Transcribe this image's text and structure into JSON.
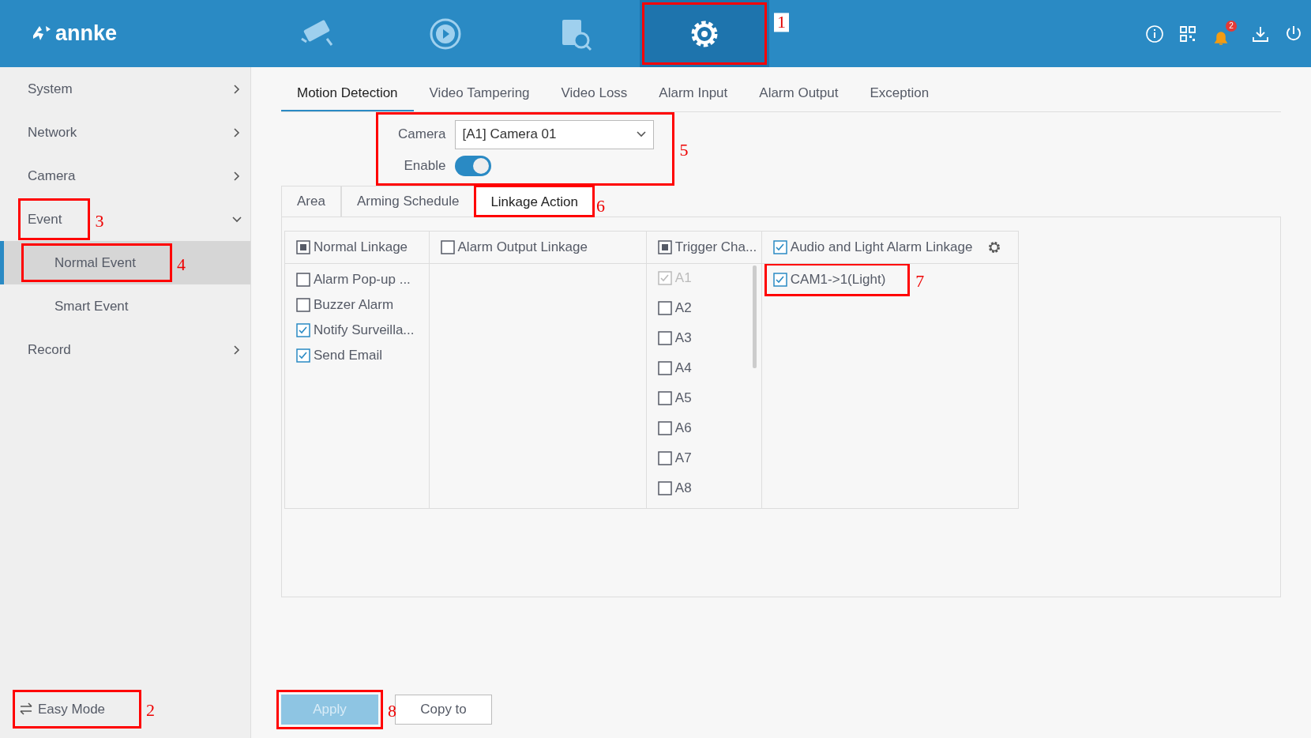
{
  "header": {
    "logo": "annke",
    "nav": [
      {
        "kind": "live",
        "selected": false
      },
      {
        "kind": "playback",
        "selected": false
      },
      {
        "kind": "search",
        "selected": false
      },
      {
        "kind": "settings",
        "selected": true,
        "callout": "1"
      }
    ],
    "tools": [
      {
        "kind": "info"
      },
      {
        "kind": "qr"
      },
      {
        "kind": "bell",
        "badge": "2"
      },
      {
        "kind": "download"
      },
      {
        "kind": "power"
      }
    ]
  },
  "sidebar": {
    "items": [
      {
        "label": "System",
        "expanded": false
      },
      {
        "label": "Network",
        "expanded": false
      },
      {
        "label": "Camera",
        "expanded": false
      },
      {
        "label": "Event",
        "expanded": true,
        "callout": "3",
        "children": [
          {
            "label": "Normal Event",
            "selected": true,
            "callout": "4"
          },
          {
            "label": "Smart Event",
            "selected": false
          }
        ]
      },
      {
        "label": "Record",
        "expanded": false
      }
    ],
    "easy_mode": {
      "label": "Easy Mode",
      "callout": "2"
    }
  },
  "tabs": [
    {
      "label": "Motion Detection",
      "selected": true
    },
    {
      "label": "Video Tampering",
      "selected": false
    },
    {
      "label": "Video Loss",
      "selected": false
    },
    {
      "label": "Alarm Input",
      "selected": false
    },
    {
      "label": "Alarm Output",
      "selected": false
    },
    {
      "label": "Exception",
      "selected": false
    }
  ],
  "form": {
    "callout": "5",
    "camera_label": "Camera",
    "camera_value": "[A1] Camera 01",
    "enable_label": "Enable",
    "enable_on": true
  },
  "subtabs": [
    {
      "label": "Area",
      "selected": false
    },
    {
      "label": "Arming Schedule",
      "selected": false
    },
    {
      "label": "Linkage Action",
      "selected": true,
      "callout": "6"
    }
  ],
  "linkage": {
    "columns": [
      {
        "title": "Normal Linkage",
        "checked": false,
        "partial": true,
        "items": [
          {
            "label": "Alarm Pop-up ...",
            "checked": false,
            "disabled": false
          },
          {
            "label": "Buzzer Alarm",
            "checked": false,
            "disabled": false
          },
          {
            "label": "Notify Surveilla...",
            "checked": true,
            "disabled": false
          },
          {
            "label": "Send Email",
            "checked": true,
            "disabled": false
          }
        ]
      },
      {
        "title": "Alarm Output Linkage",
        "checked": false,
        "partial": false
      },
      {
        "title": "Trigger Cha...",
        "checked": false,
        "partial": true,
        "scroll": true,
        "items": [
          {
            "label": "A1",
            "checked": true,
            "disabled": true
          },
          {
            "label": "A2",
            "checked": false,
            "disabled": false
          },
          {
            "label": "A3",
            "checked": false,
            "disabled": false
          },
          {
            "label": "A4",
            "checked": false,
            "disabled": false
          },
          {
            "label": "A5",
            "checked": false,
            "disabled": false
          },
          {
            "label": "A6",
            "checked": false,
            "disabled": false
          },
          {
            "label": "A7",
            "checked": false,
            "disabled": false
          },
          {
            "label": "A8",
            "checked": false,
            "disabled": false
          }
        ]
      },
      {
        "title": "Audio and Light Alarm Linkage",
        "checked": true,
        "settings": true,
        "items": [
          {
            "label": "CAM1->1(Light)",
            "checked": true,
            "disabled": false,
            "callout": "7"
          }
        ]
      }
    ]
  },
  "buttons": [
    {
      "label": "Apply",
      "kind": "primary",
      "callout": "8"
    },
    {
      "label": "Copy to",
      "kind": "secondary"
    }
  ]
}
